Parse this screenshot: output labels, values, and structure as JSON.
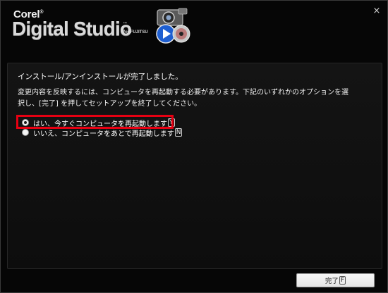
{
  "header": {
    "brand_corel": "Corel",
    "brand_corel_mark": "®",
    "brand_main": "Digital Studio",
    "brand_tm": "™",
    "brand_for": "for FUJITSU",
    "logo_icon": "camera-play-disc-icon",
    "close_icon": "×"
  },
  "main": {
    "heading": "インストール/アンインストールが完了しました。",
    "description_lines": [
      "変更内容を反映するには、コンピュータを再起動する必要があります。下記のいずれかのオプションを選",
      "択し、[完了] を押してセットアップを終了してください。"
    ],
    "options": [
      {
        "label": "はい、今すぐコンピュータを再起動します",
        "hotkey": "Y",
        "selected": true
      },
      {
        "label": "いいえ、コンピュータをあとで再起動します",
        "hotkey": "N",
        "selected": false
      }
    ]
  },
  "footer": {
    "finish_label": "完了",
    "finish_hotkey": "F"
  },
  "colors": {
    "background": "#060606",
    "highlight": "#e60012",
    "button_face": "#ececec"
  }
}
